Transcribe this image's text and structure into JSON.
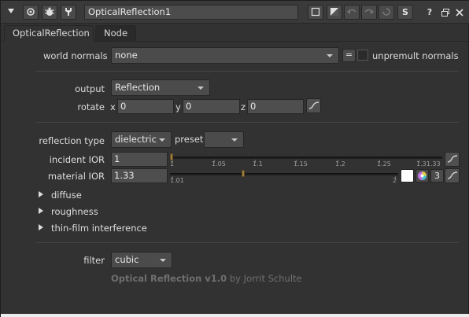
{
  "titlebar": {
    "node_name": "OpticalReflection1",
    "s_label": "S",
    "help_label": "?"
  },
  "tabs": [
    {
      "label": "OpticalReflection"
    },
    {
      "label": "Node"
    }
  ],
  "world_normals": {
    "label": "world normals",
    "value": "none",
    "equals_label": "=",
    "unpremult_label": "unpremult normals"
  },
  "output": {
    "label": "output",
    "value": "Reflection"
  },
  "rotate": {
    "label": "rotate",
    "x_label": "x",
    "x": "0",
    "y_label": "y",
    "y": "0",
    "z_label": "z",
    "z": "0"
  },
  "reflection_type": {
    "label": "reflection type",
    "value": "dielectric",
    "preset_label": "preset",
    "preset_value": ""
  },
  "incident_ior": {
    "label": "incident IOR",
    "value": "1",
    "slider_level": 1.0,
    "ticks": [
      "1",
      "1.05",
      "1.1",
      "1.15",
      "1.2",
      "1.25",
      "1.31.33"
    ]
  },
  "material_ior": {
    "label": "material IOR",
    "value": "1.33",
    "slider_level": 1.33,
    "ticks": [
      "1.01",
      "2"
    ],
    "channel_count": "3"
  },
  "sections": [
    {
      "label": "diffuse"
    },
    {
      "label": "roughness"
    },
    {
      "label": "thin-film interference"
    }
  ],
  "filter": {
    "label": "filter",
    "value": "cubic"
  },
  "footer": {
    "plugin": "Optical Reflection v1.0",
    "author": " by Jorrit Schulte"
  },
  "colors": {
    "background": "#323232",
    "field": "#4e4e4e",
    "handle": "#a08040"
  }
}
